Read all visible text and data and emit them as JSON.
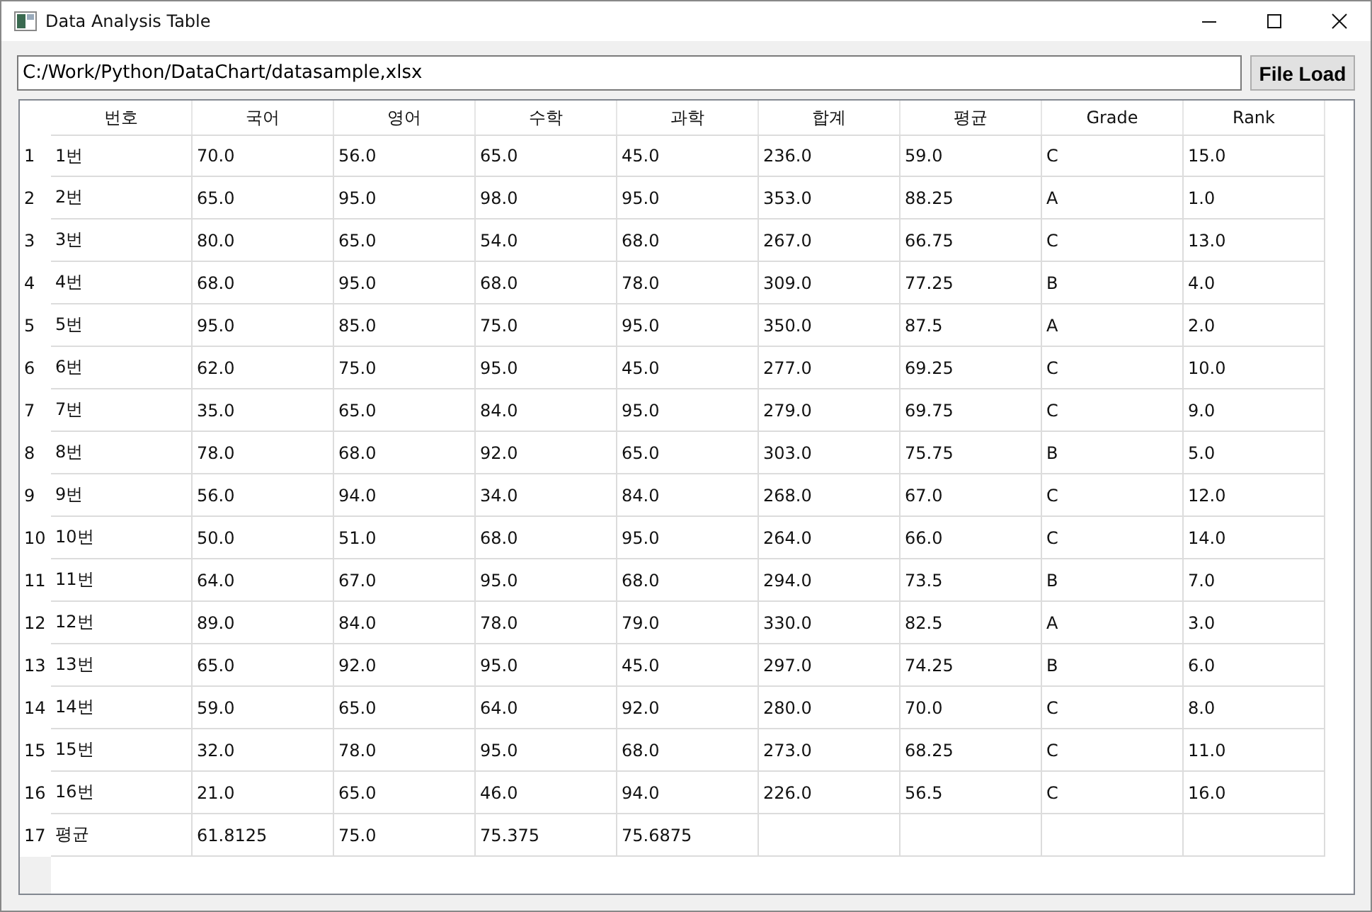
{
  "window": {
    "title": "Data Analysis Table"
  },
  "path_field": {
    "value": "C:/Work/Python/DataChart/datasample,xlsx"
  },
  "load_button": {
    "label": "File Load"
  },
  "table": {
    "columns": [
      "번호",
      "국어",
      "영어",
      "수학",
      "과학",
      "합계",
      "평균",
      "Grade",
      "Rank"
    ],
    "rows": [
      {
        "header": "1",
        "cells": [
          "1번",
          "70.0",
          "56.0",
          "65.0",
          "45.0",
          "236.0",
          "59.0",
          "C",
          "15.0"
        ]
      },
      {
        "header": "2",
        "cells": [
          "2번",
          "65.0",
          "95.0",
          "98.0",
          "95.0",
          "353.0",
          "88.25",
          "A",
          "1.0"
        ]
      },
      {
        "header": "3",
        "cells": [
          "3번",
          "80.0",
          "65.0",
          "54.0",
          "68.0",
          "267.0",
          "66.75",
          "C",
          "13.0"
        ]
      },
      {
        "header": "4",
        "cells": [
          "4번",
          "68.0",
          "95.0",
          "68.0",
          "78.0",
          "309.0",
          "77.25",
          "B",
          "4.0"
        ]
      },
      {
        "header": "5",
        "cells": [
          "5번",
          "95.0",
          "85.0",
          "75.0",
          "95.0",
          "350.0",
          "87.5",
          "A",
          "2.0"
        ]
      },
      {
        "header": "6",
        "cells": [
          "6번",
          "62.0",
          "75.0",
          "95.0",
          "45.0",
          "277.0",
          "69.25",
          "C",
          "10.0"
        ]
      },
      {
        "header": "7",
        "cells": [
          "7번",
          "35.0",
          "65.0",
          "84.0",
          "95.0",
          "279.0",
          "69.75",
          "C",
          "9.0"
        ]
      },
      {
        "header": "8",
        "cells": [
          "8번",
          "78.0",
          "68.0",
          "92.0",
          "65.0",
          "303.0",
          "75.75",
          "B",
          "5.0"
        ]
      },
      {
        "header": "9",
        "cells": [
          "9번",
          "56.0",
          "94.0",
          "34.0",
          "84.0",
          "268.0",
          "67.0",
          "C",
          "12.0"
        ]
      },
      {
        "header": "10",
        "cells": [
          "10번",
          "50.0",
          "51.0",
          "68.0",
          "95.0",
          "264.0",
          "66.0",
          "C",
          "14.0"
        ]
      },
      {
        "header": "11",
        "cells": [
          "11번",
          "64.0",
          "67.0",
          "95.0",
          "68.0",
          "294.0",
          "73.5",
          "B",
          "7.0"
        ]
      },
      {
        "header": "12",
        "cells": [
          "12번",
          "89.0",
          "84.0",
          "78.0",
          "79.0",
          "330.0",
          "82.5",
          "A",
          "3.0"
        ]
      },
      {
        "header": "13",
        "cells": [
          "13번",
          "65.0",
          "92.0",
          "95.0",
          "45.0",
          "297.0",
          "74.25",
          "B",
          "6.0"
        ]
      },
      {
        "header": "14",
        "cells": [
          "14번",
          "59.0",
          "65.0",
          "64.0",
          "92.0",
          "280.0",
          "70.0",
          "C",
          "8.0"
        ]
      },
      {
        "header": "15",
        "cells": [
          "15번",
          "32.0",
          "78.0",
          "95.0",
          "68.0",
          "273.0",
          "68.25",
          "C",
          "11.0"
        ]
      },
      {
        "header": "16",
        "cells": [
          "16번",
          "21.0",
          "65.0",
          "46.0",
          "94.0",
          "226.0",
          "56.5",
          "C",
          "16.0"
        ]
      },
      {
        "header": "17",
        "cells": [
          "평균",
          "61.8125",
          "75.0",
          "75.375",
          "75.6875"
        ]
      }
    ]
  }
}
